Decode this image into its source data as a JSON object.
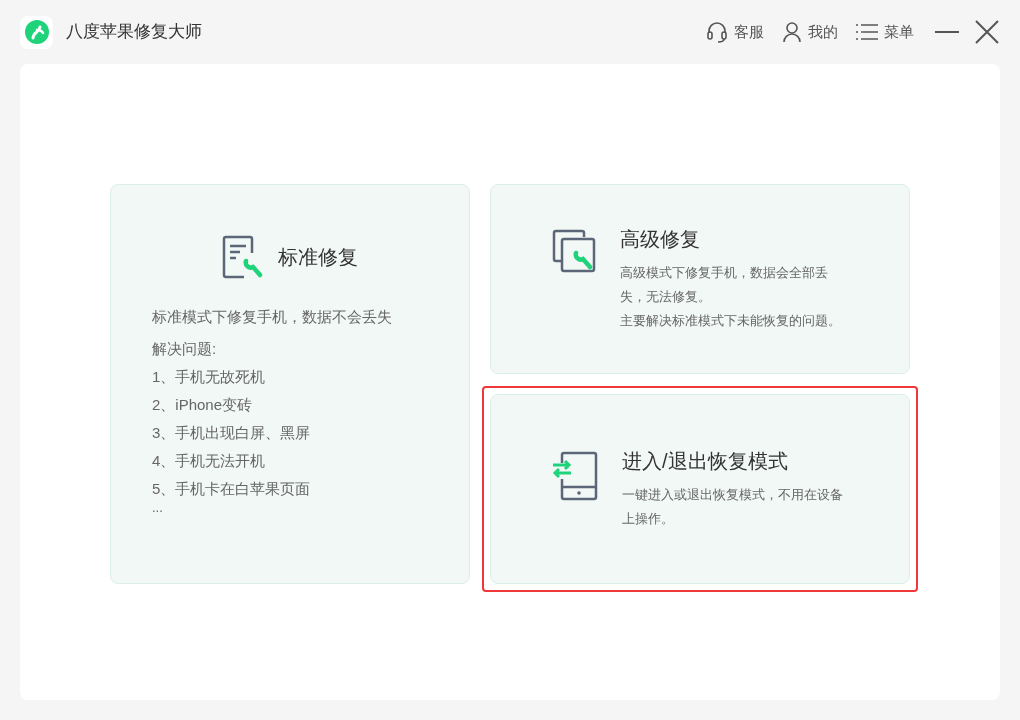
{
  "window": {
    "title": "八度苹果修复大师",
    "actions": [
      {
        "kind": "service",
        "label": "客服"
      },
      {
        "kind": "account",
        "label": "我的"
      },
      {
        "kind": "menu",
        "label": "菜单"
      }
    ]
  },
  "cards": [
    {
      "kind": "detailed",
      "title": "标准修复",
      "selected": false,
      "description": [
        "标准模式下修复手机，数据不会丢失"
      ],
      "list_title": "解决问题:",
      "items": [
        "1、手机无故死机",
        "2、iPhone变砖",
        "3、手机出现白屏、黑屏",
        "4、手机无法开机",
        "5、手机卡在白苹果页面"
      ],
      "more": "..."
    },
    {
      "kind": "compact",
      "title": "高级修复",
      "selected": false,
      "description": [
        "高级模式下修复手机，数据会全部丢失，无法修复。",
        "主要解决标准模式下未能恢复的问题。"
      ]
    },
    {
      "kind": "compact",
      "title": "进入/退出恢复模式",
      "selected": true,
      "description": [
        "一键进入或退出恢复模式，不用在设备上操作。"
      ]
    }
  ]
}
